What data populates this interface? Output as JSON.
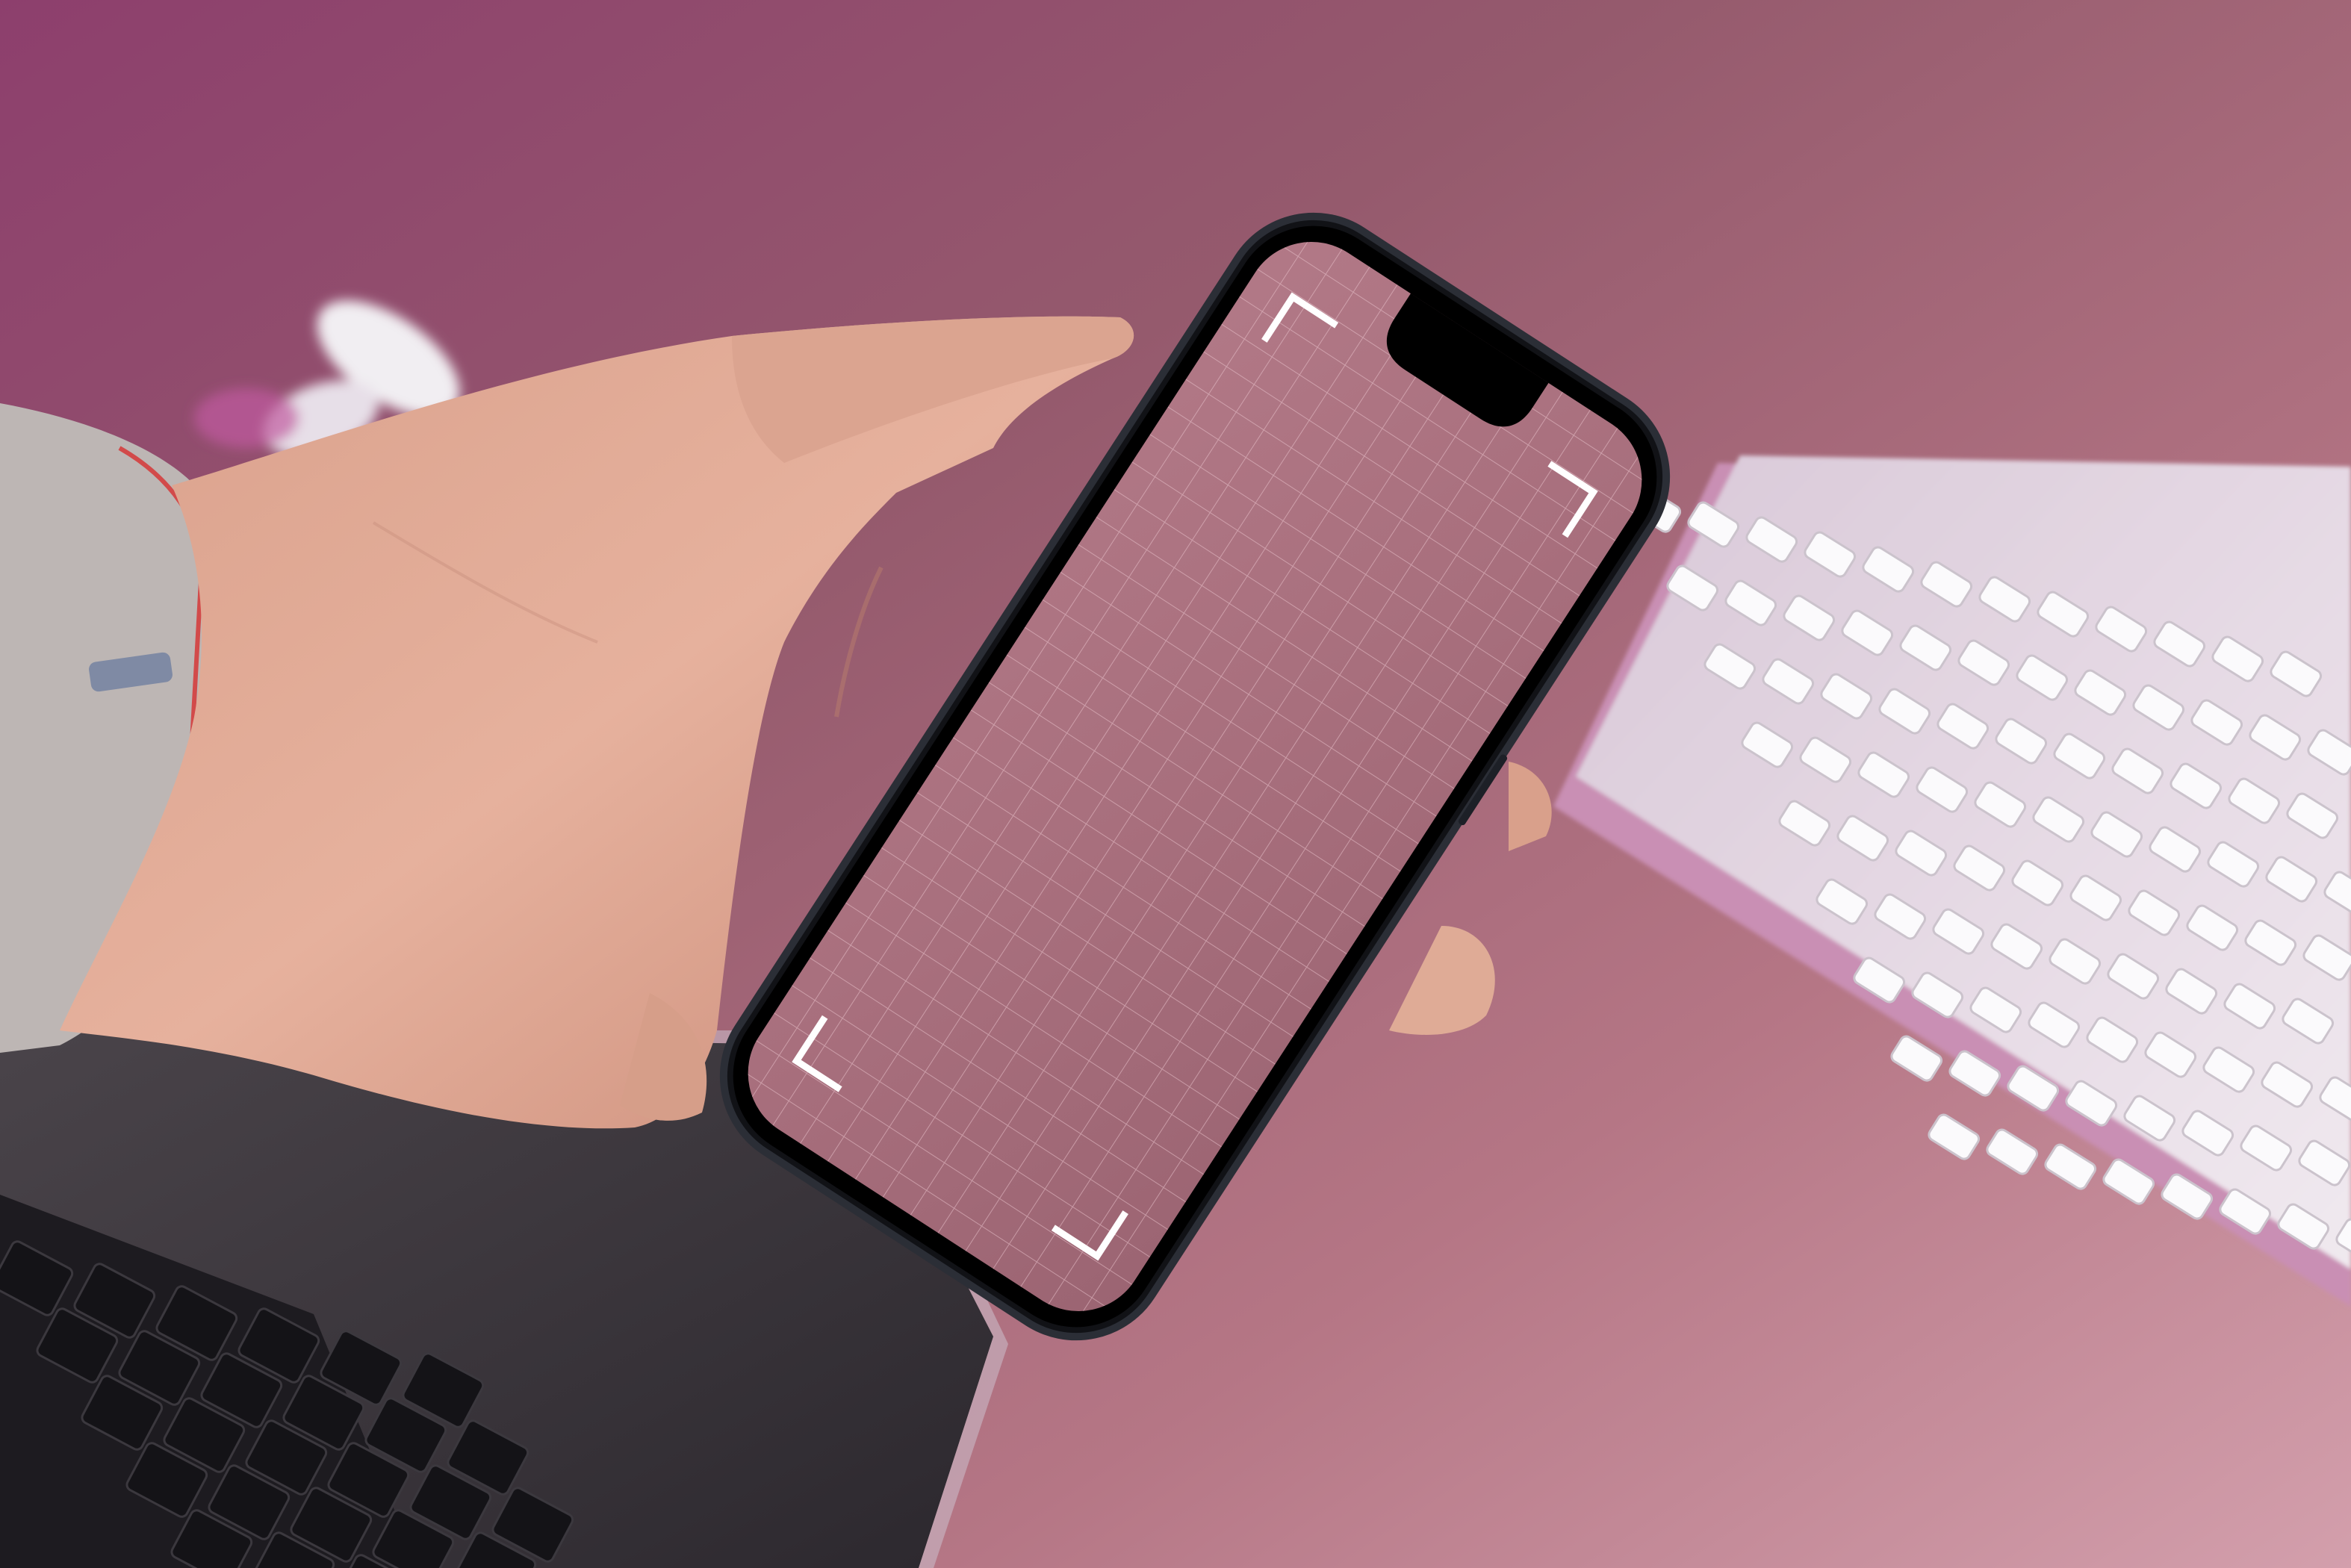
{
  "scene": {
    "background_color": "#a86a80",
    "objects": [
      {
        "name": "hand",
        "color": "#e2a88f"
      },
      {
        "name": "smartphone",
        "color": "#1a1c22"
      },
      {
        "name": "phone-screen",
        "color": "#b07a86"
      },
      {
        "name": "laptop",
        "color": "#3a353b"
      },
      {
        "name": "keyboard",
        "color": "#e4e2e6"
      },
      {
        "name": "earbuds",
        "color": "#f1eef2"
      },
      {
        "name": "wristband",
        "color": "#bfb9b7"
      }
    ],
    "screen_overlay": {
      "grid_color": "#e8c3cb",
      "corner_marker_color": "#ffffff"
    }
  }
}
